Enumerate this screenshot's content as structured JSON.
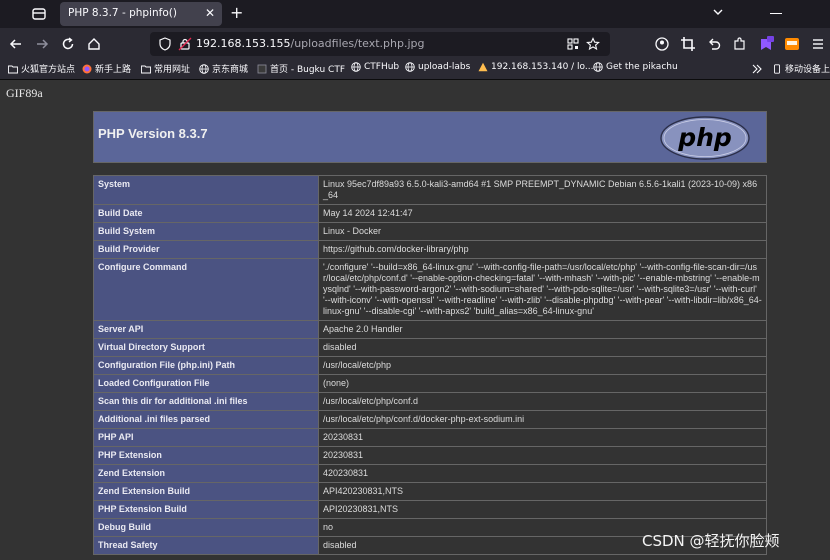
{
  "browser": {
    "tab_title": "PHP 8.3.7 - phpinfo()",
    "tab_close": "✕",
    "new_tab": "+",
    "url_host": "192.168.153.155",
    "url_path": "/uploadfiles/text.php.jpg"
  },
  "bookmarks": [
    {
      "icon": "folder-icon",
      "label": "火狐官方站点"
    },
    {
      "icon": "firefox-icon",
      "label": "新手上路"
    },
    {
      "icon": "folder-icon",
      "label": "常用网址"
    },
    {
      "icon": "globe-icon",
      "label": "京东商城"
    },
    {
      "icon": "bugku-icon",
      "label": "首页 - Bugku CTF"
    },
    {
      "icon": "globe-icon",
      "label": "CTFHub"
    },
    {
      "icon": "globe-icon",
      "label": "upload-labs"
    },
    {
      "icon": "warning-icon",
      "label": "192.168.153.140 / lo..."
    },
    {
      "icon": "globe-icon",
      "label": "Get the pikachu"
    },
    {
      "icon": "mobile-icon",
      "label": "移动设备上的"
    }
  ],
  "page": {
    "gif_header": "GIF89a",
    "php_version_title": "PHP Version 8.3.7",
    "rows": [
      {
        "key": "System",
        "value": "Linux 95ec7df89a93 6.5.0-kali3-amd64 #1 SMP PREEMPT_DYNAMIC Debian 6.5.6-1kali1 (2023-10-09) x86_64"
      },
      {
        "key": "Build Date",
        "value": "May 14 2024 12:41:47"
      },
      {
        "key": "Build System",
        "value": "Linux - Docker"
      },
      {
        "key": "Build Provider",
        "value": "https://github.com/docker-library/php"
      },
      {
        "key": "Configure Command",
        "value": "'./configure' '--build=x86_64-linux-gnu' '--with-config-file-path=/usr/local/etc/php' '--with-config-file-scan-dir=/usr/local/etc/php/conf.d' '--enable-option-checking=fatal' '--with-mhash' '--with-pic' '--enable-mbstring' '--enable-mysqlnd' '--with-password-argon2' '--with-sodium=shared' '--with-pdo-sqlite=/usr' '--with-sqlite3=/usr' '--with-curl' '--with-iconv' '--with-openssl' '--with-readline' '--with-zlib' '--disable-phpdbg' '--with-pear' '--with-libdir=lib/x86_64-linux-gnu' '--disable-cgi' '--with-apxs2' 'build_alias=x86_64-linux-gnu'"
      },
      {
        "key": "Server API",
        "value": "Apache 2.0 Handler"
      },
      {
        "key": "Virtual Directory Support",
        "value": "disabled"
      },
      {
        "key": "Configuration File (php.ini) Path",
        "value": "/usr/local/etc/php"
      },
      {
        "key": "Loaded Configuration File",
        "value": "(none)"
      },
      {
        "key": "Scan this dir for additional .ini files",
        "value": "/usr/local/etc/php/conf.d"
      },
      {
        "key": "Additional .ini files parsed",
        "value": "/usr/local/etc/php/conf.d/docker-php-ext-sodium.ini"
      },
      {
        "key": "PHP API",
        "value": "20230831"
      },
      {
        "key": "PHP Extension",
        "value": "20230831"
      },
      {
        "key": "Zend Extension",
        "value": "420230831"
      },
      {
        "key": "Zend Extension Build",
        "value": "API420230831,NTS"
      },
      {
        "key": "PHP Extension Build",
        "value": "API20230831,NTS"
      },
      {
        "key": "Debug Build",
        "value": "no"
      },
      {
        "key": "Thread Safety",
        "value": "disabled"
      }
    ],
    "watermark": "CSDN @轻抚你脸颊"
  },
  "colors": {
    "header_bg": "#5b6699",
    "key_cell_bg": "#4b5382",
    "page_bg": "#333333",
    "chrome_bg": "#1c1b22"
  }
}
